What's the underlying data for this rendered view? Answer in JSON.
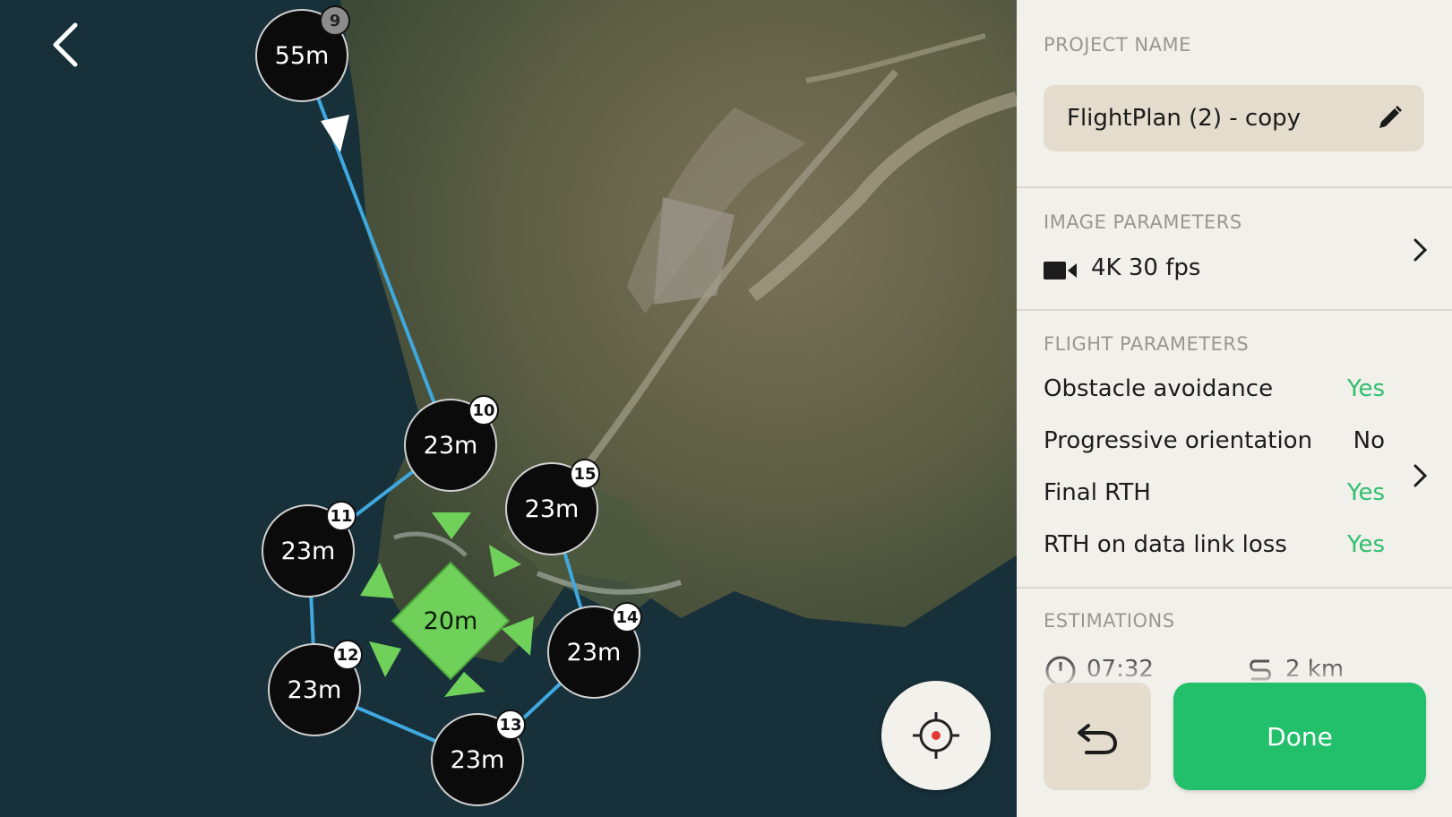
{
  "map": {
    "waypoints": [
      {
        "number": "9",
        "altitude": "55m"
      },
      {
        "number": "10",
        "altitude": "23m"
      },
      {
        "number": "11",
        "altitude": "23m"
      },
      {
        "number": "12",
        "altitude": "23m"
      },
      {
        "number": "13",
        "altitude": "23m"
      },
      {
        "number": "14",
        "altitude": "23m"
      },
      {
        "number": "15",
        "altitude": "23m"
      }
    ],
    "poi": {
      "altitude": "20m"
    },
    "colors": {
      "route": "#3fa9df",
      "poi": "#6fd05a",
      "water": "#17303a"
    }
  },
  "panel": {
    "project_name": {
      "label": "PROJECT NAME",
      "value": "FlightPlan (2) - copy"
    },
    "image_parameters": {
      "label": "IMAGE PARAMETERS",
      "value": "4K 30 fps"
    },
    "flight_parameters": {
      "label": "FLIGHT PARAMETERS",
      "items": [
        {
          "label": "Obstacle avoidance",
          "value": "Yes",
          "color": "#2fbf6f"
        },
        {
          "label": "Progressive orientation",
          "value": "No",
          "color": "#1c1c1c"
        },
        {
          "label": "Final RTH",
          "value": "Yes",
          "color": "#2fbf6f"
        },
        {
          "label": "RTH on data link loss",
          "value": "Yes",
          "color": "#2fbf6f"
        }
      ]
    },
    "estimations": {
      "label": "ESTIMATIONS",
      "duration": "07:32",
      "distance": "2 km"
    },
    "done_label": "Done",
    "accent": "#22c06a"
  }
}
